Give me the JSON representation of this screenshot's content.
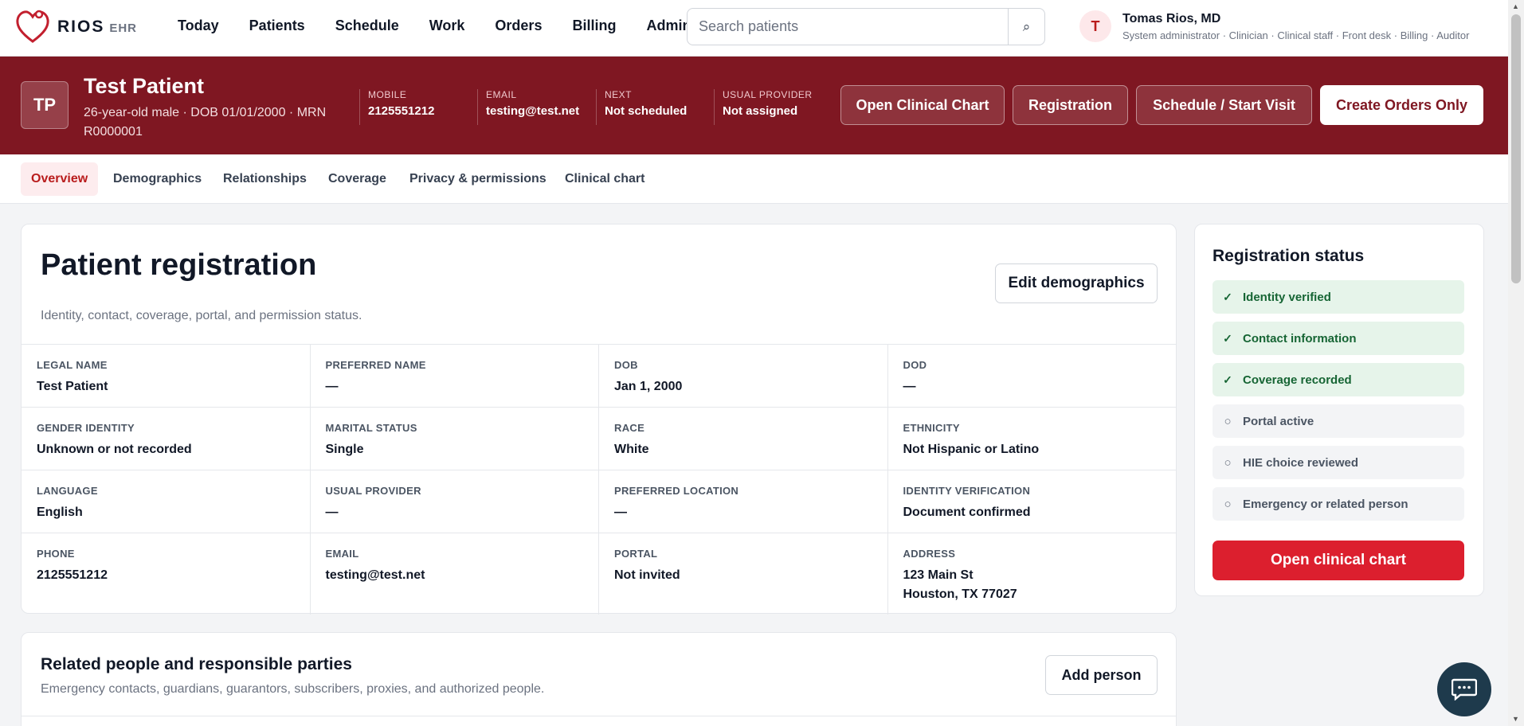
{
  "brand": {
    "name": "RIOS",
    "sub": "EHR"
  },
  "nav": [
    "Today",
    "Patients",
    "Schedule",
    "Work",
    "Orders",
    "Billing",
    "Administ"
  ],
  "search": {
    "placeholder": "Search patients",
    "button": "⌕"
  },
  "user": {
    "initial": "T",
    "name": "Tomas Rios, MD",
    "roles": "System administrator · Clinician · Clinical staff · Front desk · Billing · Auditor"
  },
  "patient": {
    "initials": "TP",
    "name": "Test Patient",
    "info": "26-year-old male · DOB 01/01/2000 · MRN R0000001",
    "facts": [
      {
        "label": "MOBILE",
        "value": "2125551212"
      },
      {
        "label": "EMAIL",
        "value": "testing@test.net"
      },
      {
        "label": "NEXT",
        "value": "Not scheduled"
      },
      {
        "label": "USUAL PROVIDER",
        "value": "Not assigned"
      }
    ],
    "actions": [
      "Open Clinical Chart",
      "Registration",
      "Schedule / Start Visit",
      "Create Orders Only"
    ]
  },
  "tabs": [
    "Overview",
    "Demographics",
    "Relationships",
    "Coverage",
    "Privacy & permissions",
    "Clinical chart"
  ],
  "registration": {
    "title": "Patient registration",
    "subtitle": "Identity, contact, coverage, portal, and permission status.",
    "edit_button": "Edit demographics",
    "fields": [
      {
        "label": "LEGAL NAME",
        "value": "Test Patient"
      },
      {
        "label": "PREFERRED NAME",
        "value": "—"
      },
      {
        "label": "DOB",
        "value": "Jan 1, 2000"
      },
      {
        "label": "DOD",
        "value": "—"
      },
      {
        "label": "GENDER IDENTITY",
        "value": "Unknown or not recorded"
      },
      {
        "label": "MARITAL STATUS",
        "value": "Single"
      },
      {
        "label": "RACE",
        "value": "White"
      },
      {
        "label": "ETHNICITY",
        "value": "Not Hispanic or Latino"
      },
      {
        "label": "LANGUAGE",
        "value": "English"
      },
      {
        "label": "USUAL PROVIDER",
        "value": "—"
      },
      {
        "label": "PREFERRED LOCATION",
        "value": "—"
      },
      {
        "label": "IDENTITY VERIFICATION",
        "value": "Document confirmed"
      },
      {
        "label": "PHONE",
        "value": "2125551212"
      },
      {
        "label": "EMAIL",
        "value": "testing@test.net"
      },
      {
        "label": "PORTAL",
        "value": "Not invited"
      },
      {
        "label": "ADDRESS",
        "value": "123 Main St\nHouston, TX 77027"
      }
    ]
  },
  "status": {
    "title": "Registration status",
    "items": [
      {
        "label": "Identity verified",
        "done": true
      },
      {
        "label": "Contact information",
        "done": true
      },
      {
        "label": "Coverage recorded",
        "done": true
      },
      {
        "label": "Portal active",
        "done": false
      },
      {
        "label": "HIE choice reviewed",
        "done": false
      },
      {
        "label": "Emergency or related person",
        "done": false
      }
    ],
    "button": "Open clinical chart"
  },
  "related": {
    "title": "Related people and responsible parties",
    "subtitle": "Emergency contacts, guardians, guarantors, subscribers, proxies, and authorized people.",
    "add_button": "Add person"
  },
  "colors": {
    "banner": "#7f1722",
    "accent": "#dc1f2e",
    "chat": "#1e3a4c"
  }
}
